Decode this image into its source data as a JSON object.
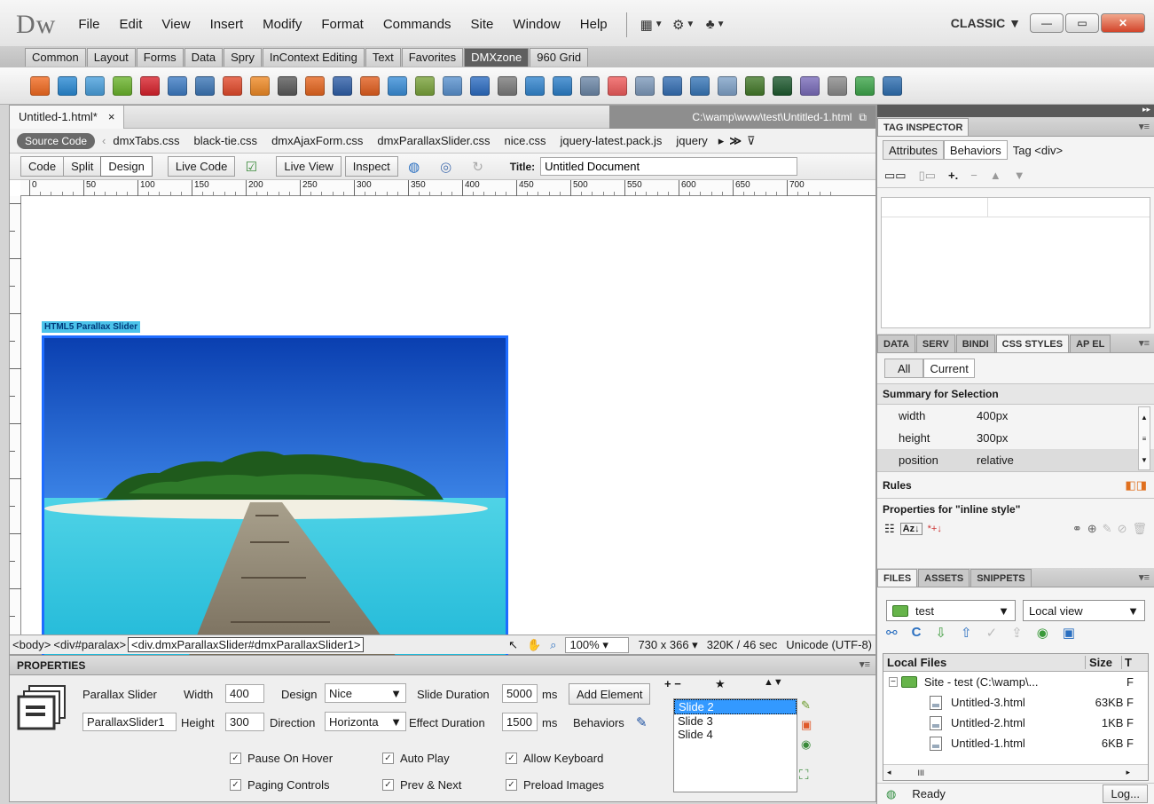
{
  "app": {
    "logo": "Dw",
    "menu": [
      "File",
      "Edit",
      "View",
      "Insert",
      "Modify",
      "Format",
      "Commands",
      "Site",
      "Window",
      "Help"
    ],
    "workspace": "CLASSIC"
  },
  "insert_tabs": [
    "Common",
    "Layout",
    "Forms",
    "Data",
    "Spry",
    "InContext Editing",
    "Text",
    "Favorites",
    "DMXzone",
    "960 Grid"
  ],
  "insert_active": "DMXzone",
  "toolbar_icon_colors": [
    "#f26b21",
    "#2a8ad4",
    "#4aa0dd",
    "#6bb42c",
    "#d9232d",
    "#3e7cc4",
    "#3c76b6",
    "#e34b2c",
    "#ef8a26",
    "#5a5a5a",
    "#e6661f",
    "#2f5fa8",
    "#e25f1f",
    "#3a8ed8",
    "#7aa33b",
    "#5a92cf",
    "#2d6dc2",
    "#7b7b7b",
    "#3386cf",
    "#2c7fc9",
    "#6d88a8",
    "#ef5c5c",
    "#7e9abb",
    "#356fb4",
    "#3877b8",
    "#7fa2c8",
    "#447a2a",
    "#1e5a2f",
    "#7a6cba",
    "#8b8b8b",
    "#3ea64b",
    "#2f6fb1"
  ],
  "document": {
    "tab_label": "Untitled-1.html*",
    "tab_close": "×",
    "path": "C:\\wamp\\www\\test\\Untitled-1.html",
    "source_code": "Source Code",
    "related_files": [
      "dmxTabs.css",
      "black-tie.css",
      "dmxAjaxForm.css",
      "dmxParallaxSlider.css",
      "nice.css",
      "jquery-latest.pack.js",
      "jquery"
    ],
    "view_buttons": [
      "Code",
      "Split",
      "Design"
    ],
    "active_view": "Design",
    "live_code": "Live Code",
    "live_view": "Live View",
    "inspect": "Inspect",
    "title_label": "Title:",
    "title_value": "Untitled Document",
    "ruler_labels": [
      "0",
      "50",
      "100",
      "150",
      "200",
      "250",
      "300",
      "350",
      "400",
      "450",
      "500",
      "550",
      "600",
      "650",
      "700"
    ],
    "slider_label": "HTML5 Parallax Slider"
  },
  "status_bar": {
    "tags": [
      "<body>",
      "<div#paralax>"
    ],
    "selected_tag": "<div.dmxParallaxSlider#dmxParallaxSlider1>",
    "zoom": "100%",
    "dimensions": "730 x 366",
    "filesize": "320K / 46 sec",
    "encoding": "Unicode (UTF-8)"
  },
  "properties": {
    "header": "PROPERTIES",
    "widget_name": "Parallax Slider",
    "id_value": "ParallaxSlider1",
    "width_label": "Width",
    "width_value": "400",
    "height_label": "Height",
    "height_value": "300",
    "design_label": "Design",
    "design_value": "Nice",
    "direction_label": "Direction",
    "direction_value": "Horizonta",
    "slide_duration_label": "Slide Duration",
    "slide_duration_value": "5000",
    "effect_duration_label": "Effect Duration",
    "effect_duration_value": "1500",
    "ms": "ms",
    "add_element": "Add Element",
    "behaviors": "Behaviors",
    "plus_minus": "+ −",
    "star": "★",
    "updown": "▲▼",
    "slides": [
      "Slide 2",
      "Slide 3",
      "Slide 4"
    ],
    "selected_slide": "Slide 2",
    "checkboxes": [
      "Pause On Hover",
      "Auto Play",
      "Allow Keyboard",
      "Paging Controls",
      "Prev & Next",
      "Preload Images"
    ]
  },
  "tag_inspector": {
    "title": "TAG INSPECTOR",
    "tabs": [
      "Attributes",
      "Behaviors"
    ],
    "active_tab": "Behaviors",
    "tag_label": "Tag <div>"
  },
  "css_panel": {
    "tabs": [
      "DATA",
      "SERV",
      "BINDI",
      "CSS STYLES",
      "AP EL"
    ],
    "active_tab": "CSS STYLES",
    "modes": [
      "All",
      "Current"
    ],
    "summary_title": "Summary for Selection",
    "properties": [
      {
        "name": "width",
        "value": "400px"
      },
      {
        "name": "height",
        "value": "300px"
      },
      {
        "name": "position",
        "value": "relative"
      }
    ],
    "rules_title": "Rules",
    "props_for": "Properties for \"inline style\""
  },
  "files_panel": {
    "tabs": [
      "FILES",
      "ASSETS",
      "SNIPPETS"
    ],
    "active_tab": "FILES",
    "site": "test",
    "view": "Local view",
    "col_local": "Local Files",
    "col_size": "Size",
    "col_type": "T",
    "site_root": "Site - test (C:\\wamp\\...",
    "site_root_type": "F",
    "files": [
      {
        "name": "Untitled-3.html",
        "size": "63KB",
        "type": "F"
      },
      {
        "name": "Untitled-2.html",
        "size": "1KB",
        "type": "F"
      },
      {
        "name": "Untitled-1.html",
        "size": "6KB",
        "type": "F"
      }
    ],
    "scroll_mark": "III",
    "status": "Ready",
    "log_button": "Log..."
  },
  "colors": {
    "accent_selection": "#1e6cff",
    "slider_label_bg": "#4cc3ea",
    "list_selection": "#3399ff"
  }
}
